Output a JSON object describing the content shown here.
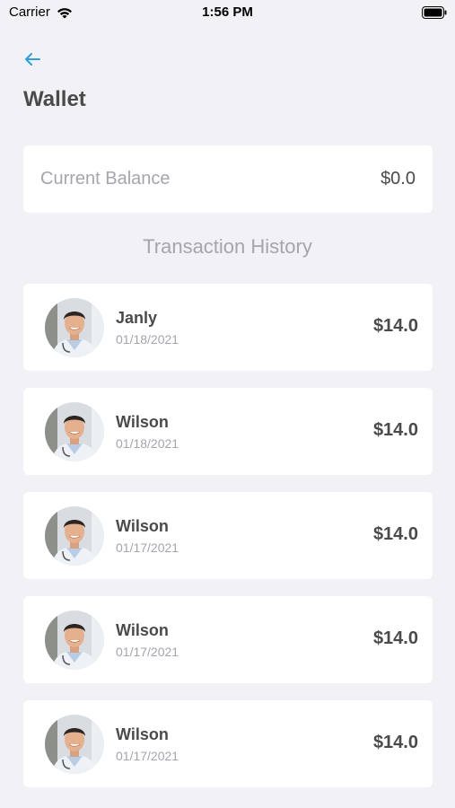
{
  "status_bar": {
    "carrier": "Carrier",
    "time": "1:56 PM"
  },
  "header": {
    "back_icon": "arrow-left-icon",
    "title": "Wallet"
  },
  "balance": {
    "label": "Current Balance",
    "value": "$0.0"
  },
  "history": {
    "heading": "Transaction History",
    "items": [
      {
        "name": "Janly",
        "date": "01/18/2021",
        "amount": "$14.0"
      },
      {
        "name": "Wilson",
        "date": "01/18/2021",
        "amount": "$14.0"
      },
      {
        "name": "Wilson",
        "date": "01/17/2021",
        "amount": "$14.0"
      },
      {
        "name": "Wilson",
        "date": "01/17/2021",
        "amount": "$14.0"
      },
      {
        "name": "Wilson",
        "date": "01/17/2021",
        "amount": "$14.0"
      }
    ]
  },
  "colors": {
    "background": "#f1f1f6",
    "accent": "#2a9fd8",
    "text_primary": "#4a4a4a",
    "text_secondary": "#a5a5ad"
  }
}
